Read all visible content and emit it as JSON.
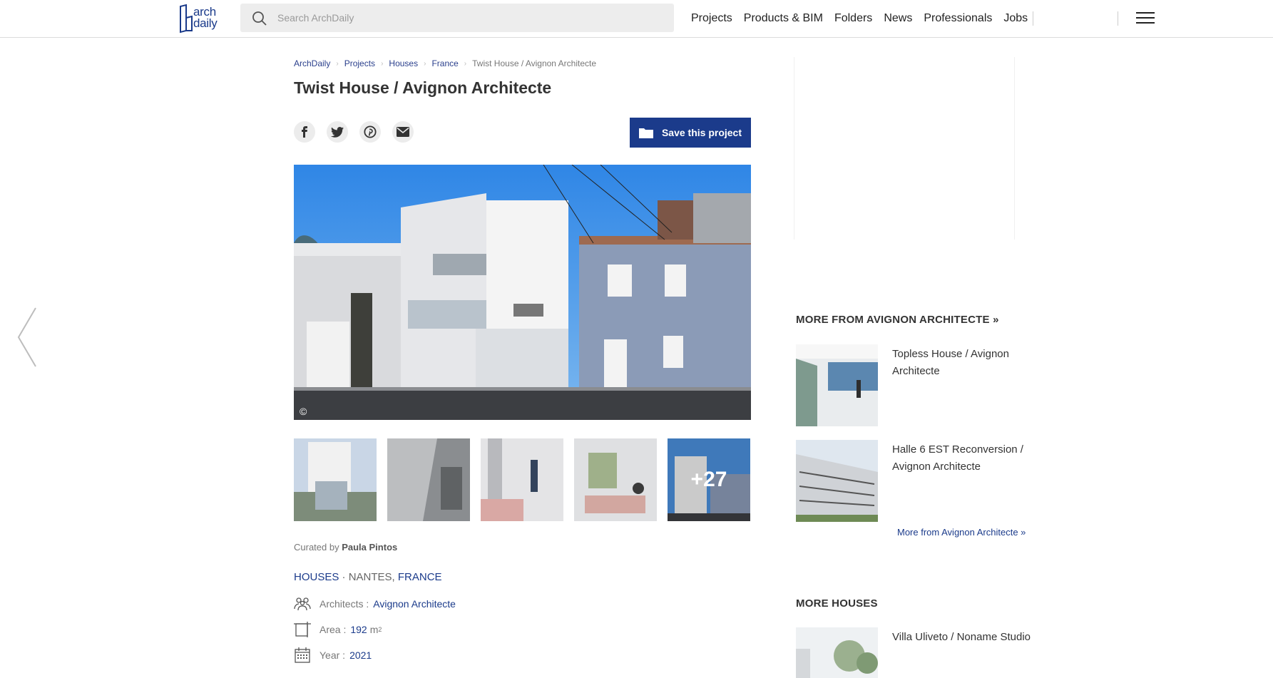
{
  "header": {
    "logo_line1": "arch",
    "logo_line2": "daily",
    "search_placeholder": "Search ArchDaily",
    "nav": [
      "Projects",
      "Products & BIM",
      "Folders",
      "News",
      "Professionals",
      "Jobs"
    ]
  },
  "breadcrumb": [
    "ArchDaily",
    "Projects",
    "Houses",
    "France",
    "Twist House / Avignon Architecte"
  ],
  "title": "Twist House / Avignon Architecte",
  "save_label": "Save this project",
  "copyright": "©",
  "thumbs_more": "+27",
  "curated": {
    "prefix": "Curated by",
    "name": "Paula Pintos"
  },
  "category": {
    "type": "HOUSES",
    "sep": " · ",
    "city": "NANTES, ",
    "country": "FRANCE"
  },
  "specs": {
    "architects": {
      "label": "Architects :",
      "value": "Avignon Architecte"
    },
    "area": {
      "label": "Area :",
      "value": "192",
      "unit": "m",
      "exp": "2"
    },
    "year": {
      "label": "Year :",
      "value": "2021"
    }
  },
  "sidebar": {
    "more_from_title": "MORE FROM AVIGNON ARCHITECTE »",
    "items": [
      {
        "title": "Topless House / Avignon Architecte"
      },
      {
        "title": "Halle 6 EST Reconversion / Avignon Architecte"
      }
    ],
    "more_link": "More from Avignon Architecte »",
    "more_houses_title": "MORE HOUSES",
    "houses": [
      {
        "title": "Villa Uliveto / Noname Studio"
      }
    ]
  },
  "colors": {
    "brand": "#1b3b8b",
    "link": "#2a3f8c"
  }
}
